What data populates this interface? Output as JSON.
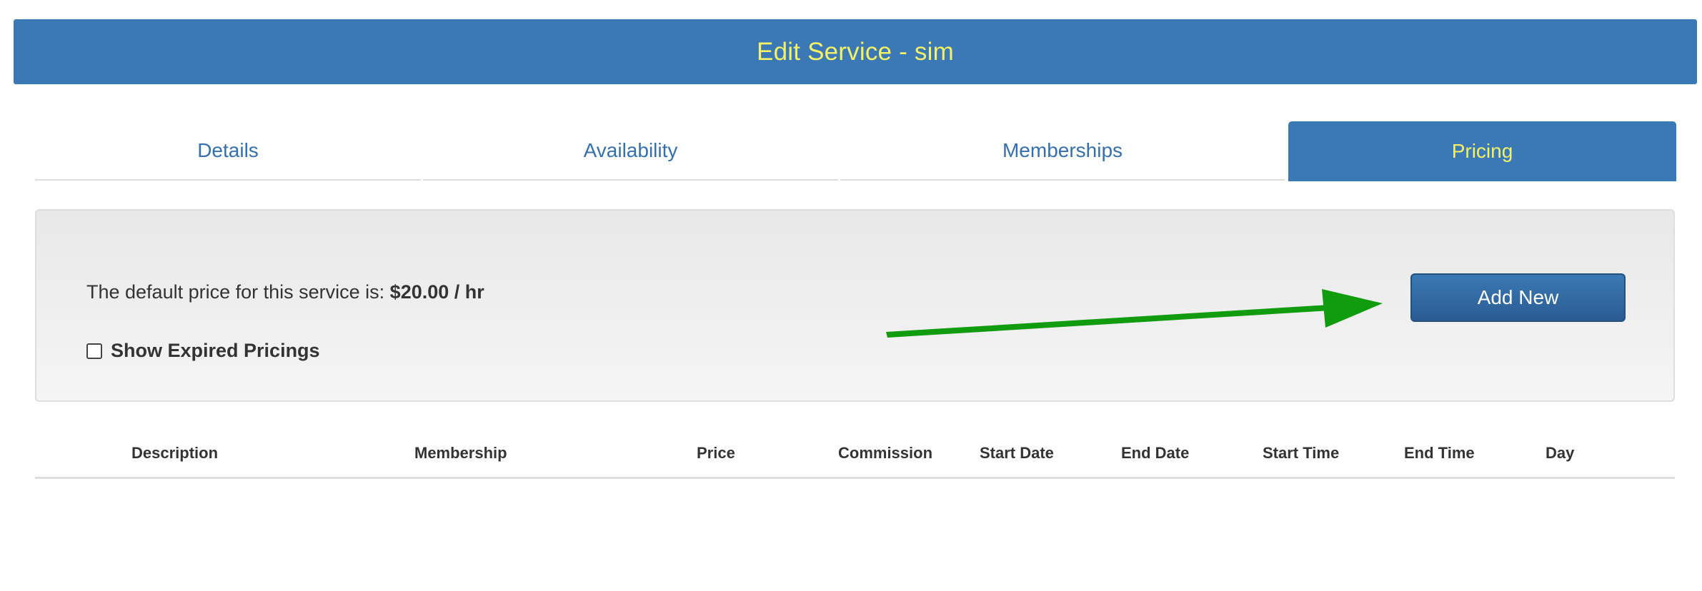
{
  "header": {
    "title": "Edit Service - sim"
  },
  "tabs": [
    {
      "label": "Details",
      "active": false
    },
    {
      "label": "Availability",
      "active": false
    },
    {
      "label": "Memberships",
      "active": false
    },
    {
      "label": "Pricing",
      "active": true
    }
  ],
  "pricing_panel": {
    "default_price_text": "The default price for this service is: ",
    "default_price_value": "$20.00 / hr",
    "show_expired_label": "Show Expired Pricings",
    "show_expired_checked": false,
    "add_new_label": "Add New"
  },
  "table": {
    "columns": [
      "Description",
      "Membership",
      "Price",
      "Commission",
      "Start Date",
      "End Date",
      "Start Time",
      "End Time",
      "Day"
    ],
    "rows": []
  },
  "colors": {
    "brand_blue": "#3b79b6",
    "title_yellow": "#f4f166",
    "arrow_green": "#119b0e"
  },
  "icons": {
    "annotation_arrow": "arrow-right-icon"
  }
}
